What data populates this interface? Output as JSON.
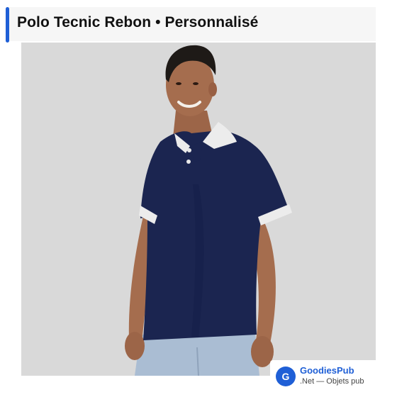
{
  "header": {
    "title": "Polo Tecnic Rebon • Personnalisé"
  },
  "product_image": {
    "alt": "Polo Tecnic Rebon • Personnalisé"
  },
  "brand": {
    "logo_letter": "G",
    "name": "GoodiesPub",
    "tagline": ".Net — Objets pub"
  },
  "colors": {
    "accent": "#1f5fd6",
    "polo_navy": "#1b2550",
    "collar_white": "#ececec",
    "background_gray": "#d9d9d9"
  }
}
